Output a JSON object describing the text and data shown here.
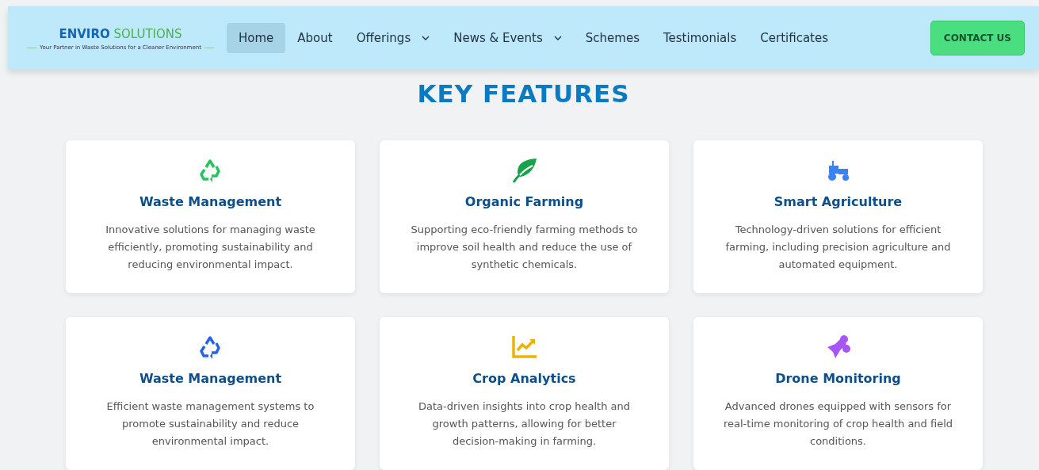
{
  "brand": {
    "name_part_1": "ENVIRO",
    "name_part_2": "SOLUTIONS",
    "tagline": "Your Partner in Waste Solutions for a Cleaner Environment"
  },
  "nav": [
    {
      "label": "Home",
      "selected": true,
      "dropdown": false
    },
    {
      "label": "About",
      "selected": false,
      "dropdown": false
    },
    {
      "label": "Offerings",
      "selected": false,
      "dropdown": true
    },
    {
      "label": "News & Events",
      "selected": false,
      "dropdown": true
    },
    {
      "label": "Schemes",
      "selected": false,
      "dropdown": false
    },
    {
      "label": "Testimonials",
      "selected": false,
      "dropdown": false
    },
    {
      "label": "Certificates",
      "selected": false,
      "dropdown": false
    }
  ],
  "contact_button": "CONTACT US",
  "section_title": "KEY FEATURES",
  "features": [
    {
      "kind": "recycle",
      "color": "#22c55e",
      "title": "Waste Management",
      "text": "Innovative solutions for managing waste efficiently, promoting sustainability and reducing environmental impact."
    },
    {
      "kind": "leaf",
      "color": "#16a34a",
      "title": "Organic Farming",
      "text": "Supporting eco-friendly farming methods to improve soil health and reduce the use of synthetic chemicals."
    },
    {
      "kind": "tractor",
      "color": "#3b82f6",
      "title": "Smart Agriculture",
      "text": "Technology-driven solutions for efficient farming, including precision agriculture and automated equipment."
    },
    {
      "kind": "recycle",
      "color": "#2563eb",
      "title": "Waste Management",
      "text": "Efficient waste management systems to promote sustainability and reduce environmental impact."
    },
    {
      "kind": "chart",
      "color": "#eab308",
      "title": "Crop Analytics",
      "text": "Data-driven insights into crop health and growth patterns, allowing for better decision-making in farming."
    },
    {
      "kind": "drone",
      "color": "#a855f7",
      "title": "Drone Monitoring",
      "text": "Advanced drones equipped with sensors for real-time monitoring of crop health and field conditions."
    }
  ]
}
